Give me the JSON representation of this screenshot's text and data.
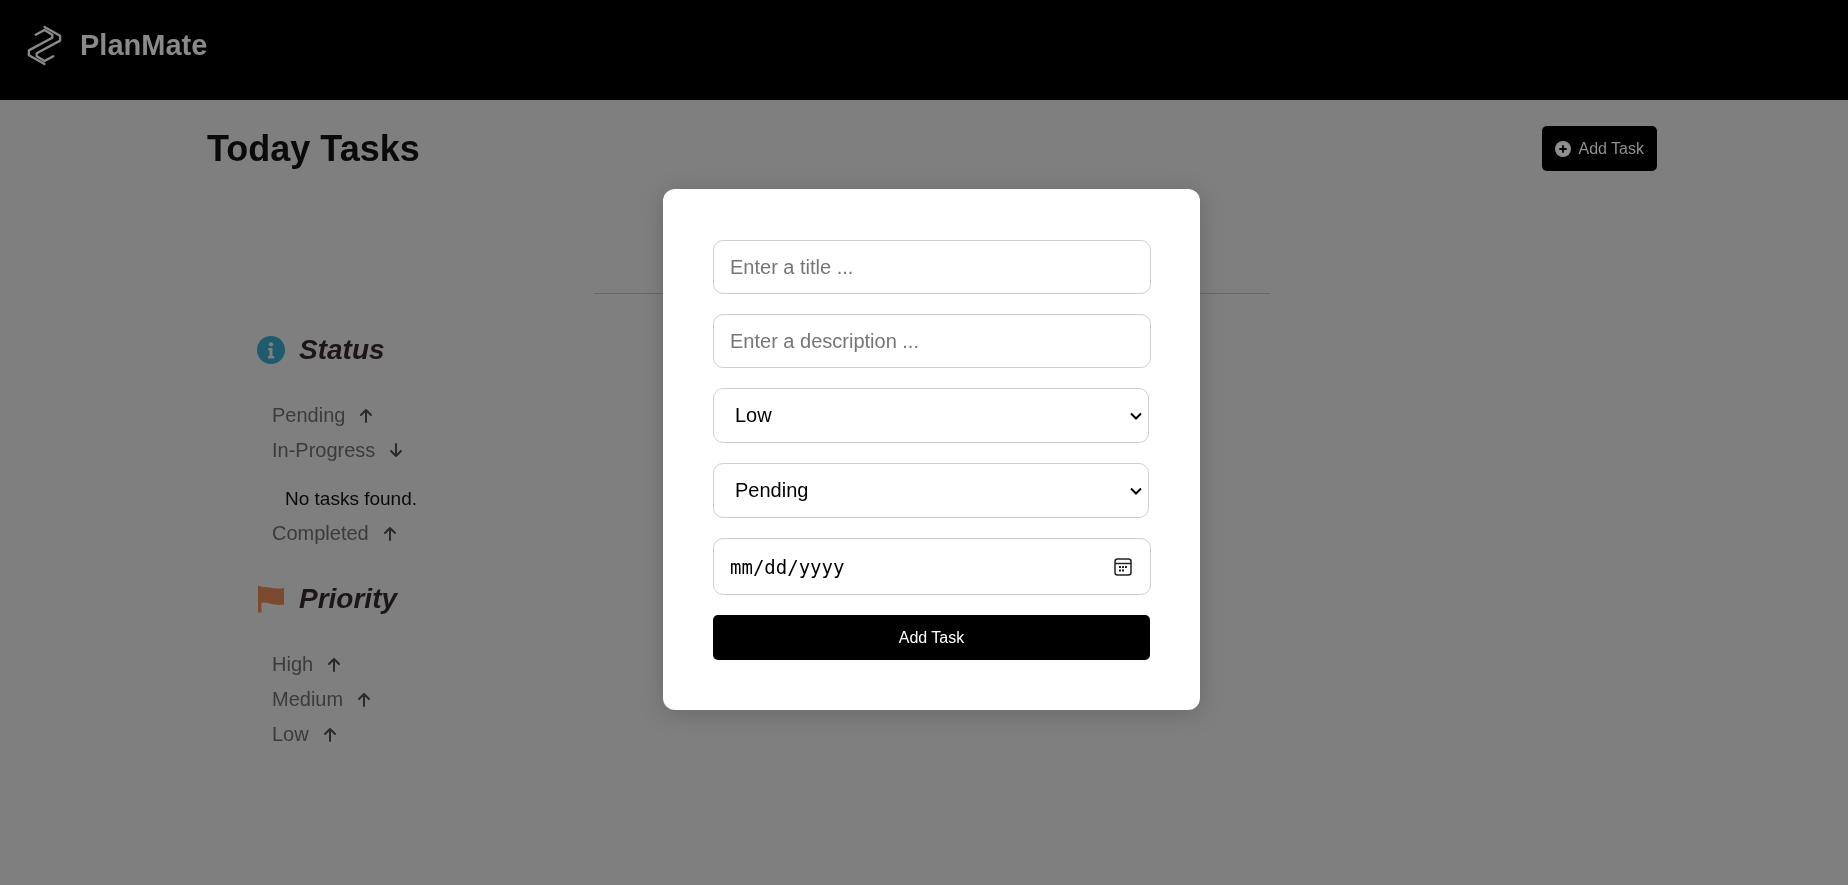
{
  "header": {
    "brand": "PlanMate"
  },
  "page": {
    "title": "Today Tasks",
    "add_button": "Add Task"
  },
  "groups": [
    {
      "kind": "status",
      "title": "Status",
      "items": [
        {
          "label": "Pending",
          "expanded": false
        },
        {
          "label": "In-Progress",
          "expanded": true,
          "message": "No tasks found."
        },
        {
          "label": "Completed",
          "expanded": false
        }
      ]
    },
    {
      "kind": "priority",
      "title": "Priority",
      "items": [
        {
          "label": "High",
          "expanded": false
        },
        {
          "label": "Medium",
          "expanded": false
        },
        {
          "label": "Low",
          "expanded": false
        }
      ]
    }
  ],
  "modal": {
    "fields": [
      {
        "kind": "text",
        "placeholder": "Enter a title ..."
      },
      {
        "kind": "text",
        "placeholder": "Enter a description ..."
      },
      {
        "kind": "select",
        "value": "Low"
      },
      {
        "kind": "select",
        "value": "Pending"
      },
      {
        "kind": "date",
        "placeholder": "mm/dd/yyyy"
      }
    ],
    "submit": "Add Task"
  }
}
